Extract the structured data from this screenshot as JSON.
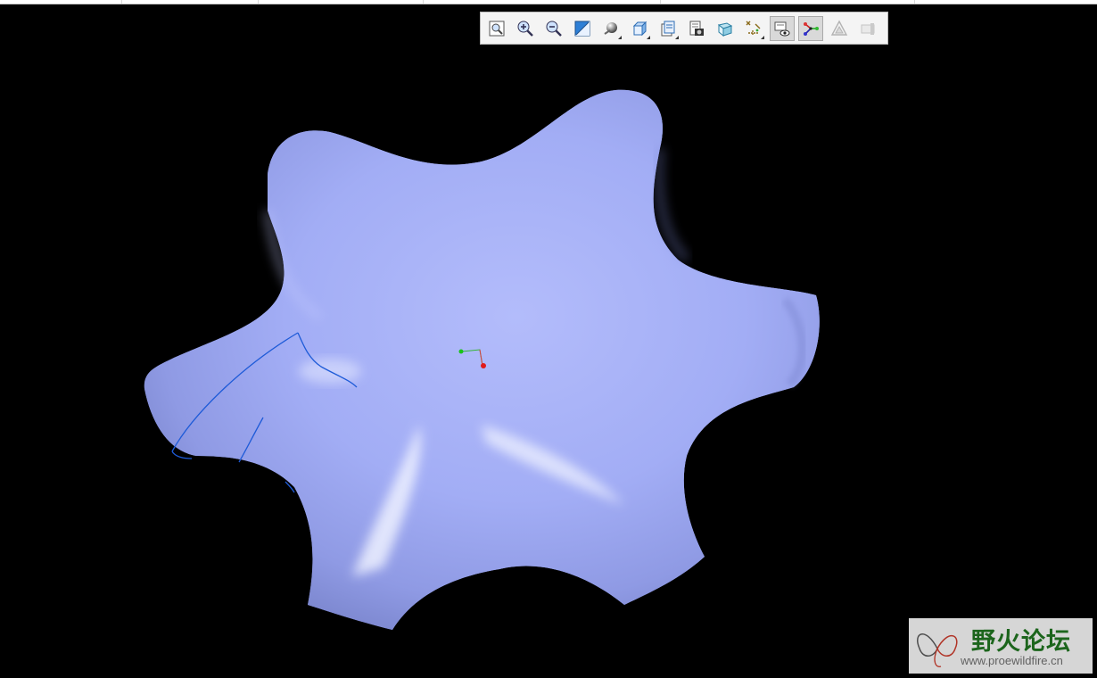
{
  "toolbar": {
    "buttons": [
      {
        "name": "refit-button",
        "icon": "refit-icon",
        "caret": false,
        "active": false
      },
      {
        "name": "zoom-in-button",
        "icon": "zoom-in-icon",
        "caret": false,
        "active": false
      },
      {
        "name": "zoom-out-button",
        "icon": "zoom-out-icon",
        "caret": false,
        "active": false
      },
      {
        "name": "repaint-button",
        "icon": "repaint-icon",
        "caret": false,
        "active": false
      },
      {
        "name": "display-style-button",
        "icon": "shaded-sphere-icon",
        "caret": true,
        "active": false
      },
      {
        "name": "saved-orientations-button",
        "icon": "cube-view-icon",
        "caret": true,
        "active": false
      },
      {
        "name": "view-manager-button",
        "icon": "view-manager-icon",
        "caret": true,
        "active": false
      },
      {
        "name": "section-button",
        "icon": "section-icon",
        "caret": false,
        "active": false
      },
      {
        "name": "perspective-button",
        "icon": "perspective-icon",
        "caret": false,
        "active": false
      },
      {
        "name": "datum-display-button",
        "icon": "datum-display-icon",
        "caret": true,
        "active": false
      },
      {
        "name": "annotation-display-button",
        "icon": "annotation-eye-icon",
        "caret": false,
        "active": true
      },
      {
        "name": "spin-center-button",
        "icon": "spin-center-icon",
        "caret": false,
        "active": true
      },
      {
        "name": "appearance-button",
        "icon": "appearance-triangle-icon",
        "caret": false,
        "active": false
      },
      {
        "name": "hidden-button",
        "icon": "hidden-item-icon",
        "caret": false,
        "active": false
      }
    ]
  },
  "colors": {
    "background": "#000000",
    "surface": "#a6b0f6",
    "edge": "#1e5bd8",
    "axis_green": "#19c419",
    "axis_red": "#e01b1b"
  },
  "watermark": {
    "title": "野火论坛",
    "url": "www.proewildfire.cn"
  }
}
